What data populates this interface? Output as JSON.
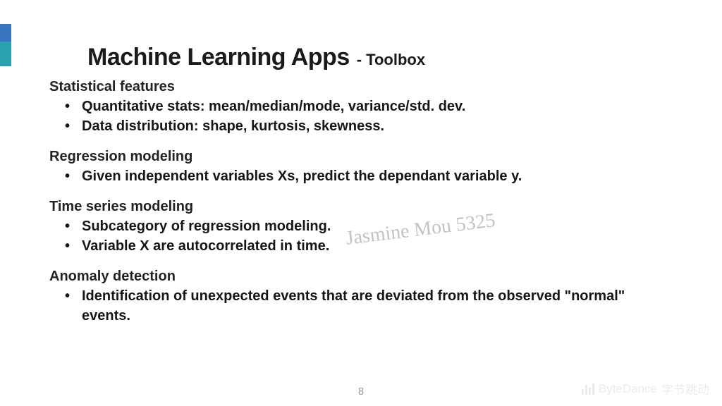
{
  "title": {
    "main": "Machine Learning Apps",
    "sub": "- Toolbox"
  },
  "sections": [
    {
      "heading": "Statistical features",
      "bullets": [
        "Quantitative stats: mean/median/mode, variance/std. dev.",
        "Data distribution: shape, kurtosis, skewness."
      ]
    },
    {
      "heading": "Regression modeling",
      "bullets": [
        "Given independent variables Xs, predict the dependant variable y."
      ]
    },
    {
      "heading": "Time series modeling",
      "bullets": [
        "Subcategory of regression modeling.",
        "Variable X are autocorrelated in time."
      ]
    },
    {
      "heading": "Anomaly detection",
      "bullets": [
        "Identification of unexpected events that are deviated from the observed \"normal\" events."
      ]
    }
  ],
  "watermark": "Jasmine Mou 5325",
  "page_number": "8",
  "brand": {
    "en": "ByteDance",
    "cn": "字节跳动"
  }
}
